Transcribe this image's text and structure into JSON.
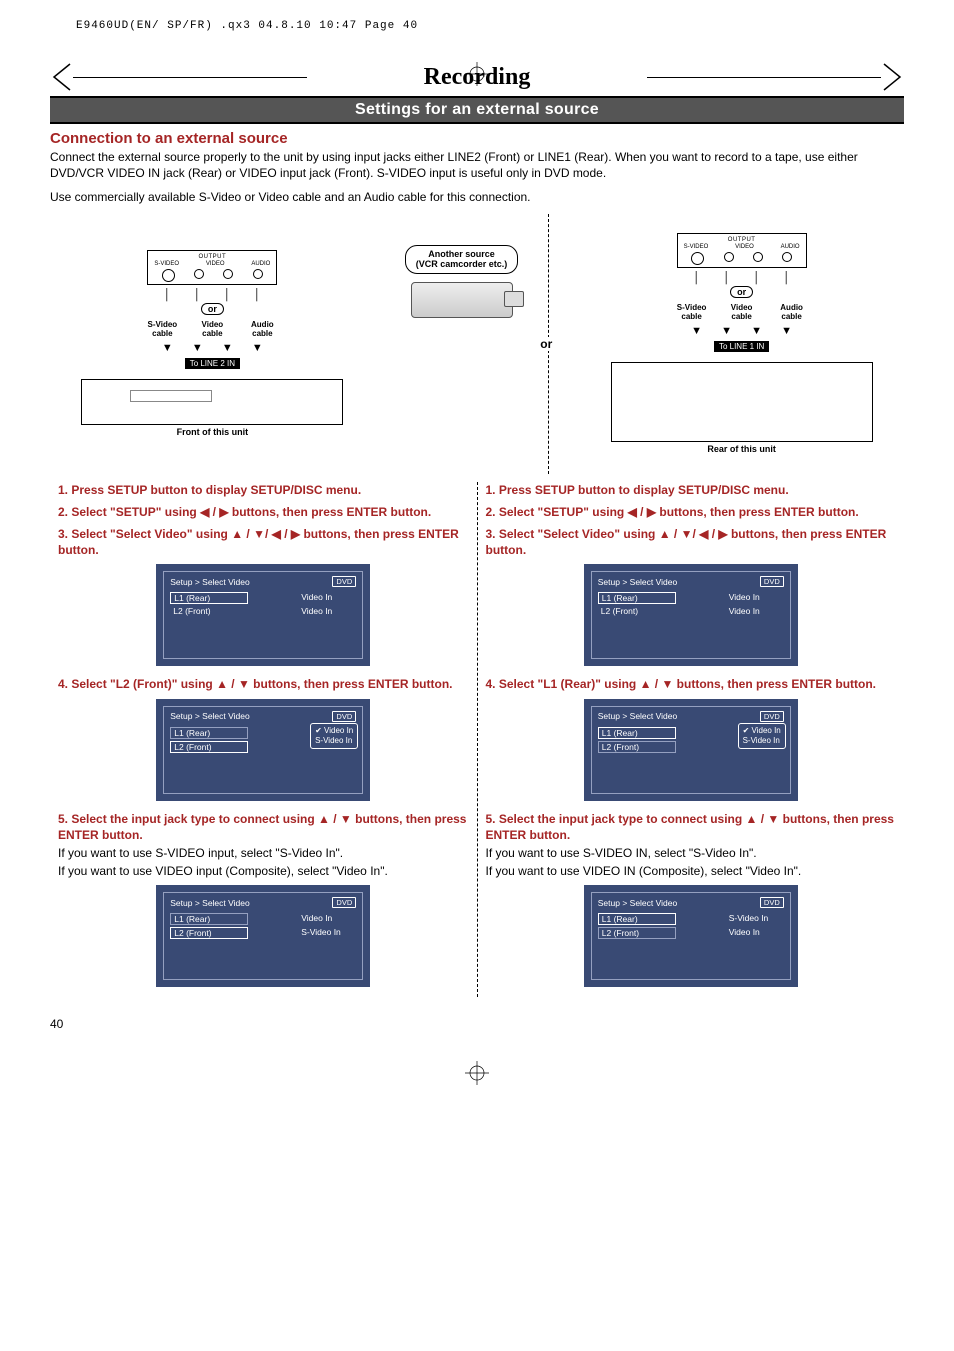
{
  "print_header": "E9460UD(EN/ SP/FR)  .qx3  04.8.10  10:47  Page 40",
  "chapter": "Recording",
  "section": "Settings for an external source",
  "sub_heading": "Connection to an external source",
  "intro": "Connect the external source properly to the unit by using input jacks either LINE2 (Front) or LINE1 (Rear). When you want to record to a tape, use either DVD/VCR VIDEO IN jack (Rear) or VIDEO input jack (Front). S-VIDEO input is useful only in DVD mode.",
  "intro2": "Use commercially available S-Video or Video cable and an Audio cable for this connection.",
  "diagram": {
    "another_source": "Another source\n(VCR camcorder etc.)",
    "output": "OUTPUT",
    "svideo": "S-VIDEO",
    "video": "VIDEO",
    "audio": "AUDIO",
    "svideo_cable": "S-Video cable",
    "video_cable": "Video cable",
    "audio_cable": "Audio cable",
    "or_pill": "or",
    "or_center": "or",
    "to_line2": "To LINE 2 IN",
    "to_line1": "To LINE 1 IN",
    "front_caption": "Front of this unit",
    "rear_caption": "Rear of this unit"
  },
  "left": {
    "step1": "1. Press SETUP button to display SETUP/DISC menu.",
    "step2": "2. Select \"SETUP\" using ◀ / ▶ buttons, then press ENTER button.",
    "step3": "3. Select \"Select Video\" using ▲ / ▼/ ◀ / ▶ buttons, then press ENTER button.",
    "step4": "4. Select \"L2 (Front)\" using ▲ / ▼ buttons, then press ENTER button.",
    "step5": "5. Select the input jack type to connect using ▲ / ▼ buttons, then press ENTER button.",
    "step5a": "If you want to use S-VIDEO input, select \"S-Video In\".",
    "step5b": "If you want to use VIDEO input (Composite), select \"Video In\".",
    "osd": {
      "title": "Setup > Select Video",
      "badge": "DVD",
      "l1": "L1 (Rear)",
      "l2": "L2 (Front)",
      "videoin": "Video In",
      "svideoin": "S-Video In"
    }
  },
  "right": {
    "step1": "1. Press SETUP button to display SETUP/DISC menu.",
    "step2": "2. Select \"SETUP\" using ◀ / ▶ buttons, then press ENTER button.",
    "step3": "3. Select \"Select Video\" using ▲ / ▼/ ◀ / ▶ buttons, then press ENTER button.",
    "step4": "4. Select \"L1 (Rear)\" using ▲ / ▼ buttons, then press ENTER button.",
    "step5": "5. Select the input jack type to connect using ▲ / ▼ buttons, then press ENTER button.",
    "step5a": "If you want to use S-VIDEO IN, select \"S-Video In\".",
    "step5b": "If you want to use VIDEO IN (Composite), select \"Video In\".",
    "osd": {
      "title": "Setup > Select Video",
      "badge": "DVD",
      "l1": "L1 (Rear)",
      "l2": "L2 (Front)",
      "videoin": "Video In",
      "svideoin": "S-Video In"
    }
  },
  "pagenum": "40"
}
